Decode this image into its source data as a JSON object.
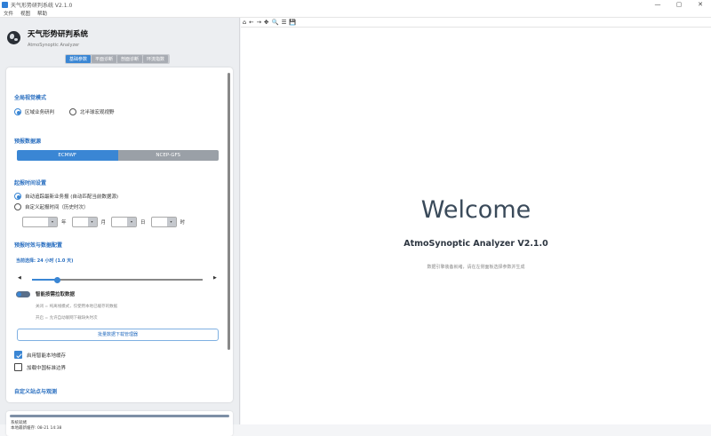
{
  "window": {
    "title": "天气形势研判系统 V2.1.0",
    "min": "—",
    "max": "▢",
    "close": "✕"
  },
  "menu": [
    "文件",
    "视图",
    "帮助"
  ],
  "brand": {
    "title": "天气形势研判系统",
    "subtitle": "AtmoSynoptic Analyzer"
  },
  "tabs": [
    "基础参数",
    "平面诊断",
    "剖面诊断",
    "环流指数"
  ],
  "sections": {
    "view_mode": {
      "title": "全局视觉模式",
      "options": [
        "区域业务研判",
        "北半球宏观视野"
      ],
      "selected": 0
    },
    "forecast_source": {
      "title": "预报数据源",
      "options": [
        "ECMWF",
        "NCEP-GFS"
      ],
      "selected": 0
    },
    "init_time": {
      "title": "起报时间设置",
      "options": [
        "自动追踪最新业务报 (自动匹配当前数据源)",
        "自定义起报时间（历史时次）"
      ],
      "selected": 0,
      "units": [
        "年",
        "月",
        "日",
        "时"
      ]
    },
    "lead_time": {
      "title": "预报时效与数据配置",
      "current": "当前选择: 24 小时 (1.0 天)",
      "slider_fraction": 0.15,
      "left_arrow": "◀",
      "right_arrow": "▶",
      "toggle_label": "智能按需拉取数据",
      "hint_off": "关闭 = 纯离线模式，仅使用本地已缓存的数据",
      "hint_on": "开启 = 允许自动联网下载缺失时次",
      "batch_button": "批量数据下载管理器"
    },
    "cache": {
      "label": "启用智能本地缓存",
      "checked": true
    },
    "border": {
      "label": "加载中国标准边界",
      "checked": false
    },
    "stations": {
      "title": "自定义站点与观测"
    }
  },
  "status": {
    "line1": "系统就绪",
    "line2": "本地最新缓存: 08-21 14:38"
  },
  "toolbar": [
    "⌂",
    "←",
    "→",
    "✥",
    "🔍",
    "☰",
    "💾"
  ],
  "welcome": {
    "heading": "Welcome",
    "app": "AtmoSynoptic Analyzer V2.1.0",
    "desc": "数据引擎装备就绪，请在左侧面板选择参数并生成"
  },
  "colors": {
    "accent": "#3a86d4",
    "segment_off": "#9aa0a7"
  }
}
